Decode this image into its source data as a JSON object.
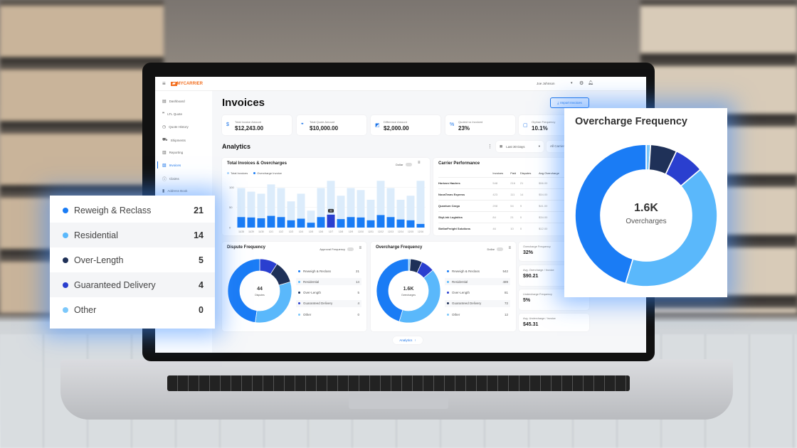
{
  "colors": {
    "blue": "#1a7cf5",
    "light": "#5ab8fb",
    "navy": "#1f3158",
    "indigo": "#2a3fcf",
    "pale": "#dcecfb",
    "accent": "#1a73e8"
  },
  "topbar": {
    "brand": "MYCARRIER",
    "user": "Joe Johnson",
    "icons": [
      "menu-icon",
      "gear-icon",
      "bell-icon"
    ]
  },
  "sidebar": {
    "items": [
      {
        "label": "Dashboard",
        "icon": "dashboard-icon"
      },
      {
        "label": "LTL Quote",
        "icon": "quote-icon"
      },
      {
        "label": "Quote History",
        "icon": "history-icon"
      },
      {
        "label": "Shipments",
        "icon": "truck-icon"
      },
      {
        "label": "Reporting",
        "icon": "bar-chart-icon"
      },
      {
        "label": "Invoices",
        "icon": "invoice-icon",
        "active": true
      },
      {
        "label": "Claims",
        "icon": "alert-icon"
      },
      {
        "label": "Address Book",
        "icon": "book-icon"
      }
    ]
  },
  "page": {
    "title": "Invoices",
    "import_label": "Import Invoices",
    "analytics_title": "Analytics",
    "date_range": "Last 30 Days",
    "carrier_filter": "All Carriers",
    "collapse_label": "Analytics"
  },
  "kpis": [
    {
      "label": "Total Invoice Amount",
      "value": "$12,243.00",
      "icon": "$"
    },
    {
      "label": "Total Quote Amount",
      "value": "$10,000.00",
      "icon": "❞"
    },
    {
      "label": "Difference Amount",
      "value": "$2,000.00",
      "icon": "◩"
    },
    {
      "label": "Quoted vs Invoiced",
      "value": "23%",
      "icon": "%"
    },
    {
      "label": "Orphan Frequency",
      "value": "10.1%",
      "icon": "▢"
    }
  ],
  "chart_data": {
    "type": "bar",
    "title": "Total Invoices & Overcharges",
    "toggle_label": "Dollar",
    "ylim": [
      0,
      120
    ],
    "yticks": [
      "0",
      "50",
      "100"
    ],
    "categories": [
      "11/28",
      "11/29",
      "11/30",
      "12/1",
      "12/2",
      "12/3",
      "12/4",
      "12/5",
      "12/6",
      "12/7",
      "12/8",
      "12/9",
      "12/10",
      "12/11",
      "12/12",
      "12/13",
      "12/14",
      "12/15",
      "12/16"
    ],
    "series": [
      {
        "name": "Total Invoices",
        "values": [
          98,
          89,
          84,
          107,
          98,
          65,
          84,
          42,
          98,
          116,
          79,
          98,
          93,
          69,
          116,
          98,
          69,
          79,
          116
        ]
      },
      {
        "name": "Overcharge Invoice",
        "values": [
          26,
          25,
          23,
          29,
          26,
          18,
          22,
          12,
          26,
          32,
          21,
          26,
          25,
          18,
          31,
          26,
          20,
          18,
          9
        ]
      }
    ],
    "highlight_index": 9,
    "tooltip": "32"
  },
  "carrier": {
    "title": "Carrier Performance",
    "columns": [
      "",
      "Invoices",
      "Paid",
      "Disputes",
      "Avg Overcharge"
    ],
    "rows": [
      [
        "Horizon Haulers",
        "548",
        "216",
        "21",
        "$56.00"
      ],
      [
        "NovaTrans Express",
        "423",
        "111",
        "14",
        "$54.00"
      ],
      [
        "Quantum Cargo",
        "208",
        "54",
        "9",
        "$41.00"
      ],
      [
        "SkyLink Logistics",
        "84",
        "21",
        "0",
        "$34.00"
      ],
      [
        "StellarFreight Solutions",
        "46",
        "10",
        "0",
        "$12.00"
      ]
    ]
  },
  "dispute": {
    "title": "Dispute Frequency",
    "toggle_label": "Approval Frequency",
    "center_value": "44",
    "center_label": "Disputes",
    "items": [
      {
        "label": "Reweigh & Reclass",
        "value": 21,
        "color": "#1a7cf5"
      },
      {
        "label": "Residential",
        "value": 14,
        "color": "#5ab8fb"
      },
      {
        "label": "Over-Length",
        "value": 5,
        "color": "#1f3158"
      },
      {
        "label": "Guaranteed Delivery",
        "value": 4,
        "color": "#2a3fcf"
      },
      {
        "label": "Other",
        "value": 0,
        "color": "#7cc8fb"
      }
    ]
  },
  "overcharge": {
    "title": "Overcharge Frequency",
    "toggle_label": "Dollar",
    "center_value": "1.6K",
    "center_label": "Overcharges",
    "items": [
      {
        "label": "Reweigh & Reclass",
        "value": 542,
        "color": "#1a7cf5"
      },
      {
        "label": "Residential",
        "value": 489,
        "color": "#5ab8fb"
      },
      {
        "label": "Over-Length",
        "value": 81,
        "color": "#2a3fcf"
      },
      {
        "label": "Guaranteed Delivery",
        "value": 72,
        "color": "#1f3158"
      },
      {
        "label": "Other",
        "value": 12,
        "color": "#7cc8fb"
      }
    ]
  },
  "metrics": [
    {
      "label": "Overcharge Frequency",
      "value": "32%"
    },
    {
      "label": "Avg. Overcharge / Invoice",
      "value": "$90.21"
    },
    {
      "label": "Undercharge Frequency",
      "value": "5%"
    },
    {
      "label": "Avg. Undercharge / Invoice",
      "value": "$45.31"
    }
  ]
}
